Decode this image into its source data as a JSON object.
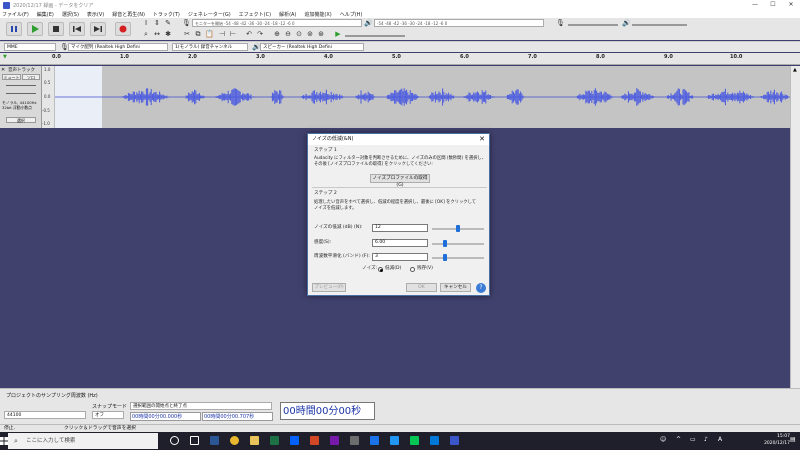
{
  "window": {
    "title": "2020/12/17 録画 - データをクリア",
    "controls": [
      "—",
      "☐",
      "✕"
    ]
  },
  "menu": [
    "ファイル(F)",
    "編集(E)",
    "選択(S)",
    "表示(V)",
    "録音と再生(N)",
    "トラック(T)",
    "ジェネレーター(G)",
    "エフェクト(C)",
    "解析(A)",
    "追加機能(X)",
    "ヘルプ(H)"
  ],
  "toolbar": {
    "monitor_label": "モニターを開始",
    "meter_scale": "-54  -48  -42  -36  -30  -24  -18  -12  -6  0",
    "meter_scale_small": "-54  -48  -42  -36  -30  -24  -18  -12  -6  0",
    "colors": {
      "play": "#2e9e2e",
      "record": "#d42020",
      "button": "#dcdcdc"
    }
  },
  "devices": {
    "host": "MME",
    "mic": "マイク配列 (Realtek High Defini",
    "channels": "1(モノラル) 録音チャンネル",
    "speaker": "スピーカー (Realtek High Defini"
  },
  "timeline": {
    "ticks": [
      "0.0",
      "1.0",
      "2.0",
      "3.0",
      "4.0",
      "5.0",
      "6.0",
      "7.0",
      "8.0",
      "9.0",
      "10.0"
    ]
  },
  "track": {
    "name": "音声トラック",
    "mute": "ミュート",
    "solo": "ソロ",
    "info_line1": "モノラル, 44100Hz",
    "info_line2": "32bit 浮動小数点",
    "select": "選択",
    "scale": [
      "1.0",
      "0.5",
      "0.0",
      "-0.5",
      "-1.0"
    ]
  },
  "dialog": {
    "title": "ノイズの低減(&N)",
    "close": "✕",
    "step1_heading": "ステップ 1",
    "step1_text1": "Audacity にフィルター対象を判断させるために、ノイズのみの区間 (数秒間) を選択し、",
    "step1_text2": "その後 [ノイズプロファイルの取得] をクリックしてください:",
    "profile_button": "ノイズプロファイルの取得(G)",
    "step2_heading": "ステップ 2",
    "step2_text1": "処理したい音声をすべて選択し、低減の程度を選択し、最後に [OK] をクリックして",
    "step2_text2": "ノイズを低減します。",
    "noise_label": "ノイズの低減 (dB) (N):",
    "noise_value": "12",
    "sensitivity_label": "感度(S):",
    "sensitivity_value": "6.00",
    "smoothing_label": "周波数平滑化 (バンド) (F):",
    "smoothing_value": "3",
    "noise_mode_label": "ノイズ:",
    "radio_reduce": "低減(D)",
    "radio_residue": "残存(V)",
    "preview_button": "プレビュー(P)",
    "ok_button": "OK",
    "cancel_button": "キャンセル",
    "help_button": "?",
    "levels": {
      "noise": 0.5,
      "sensitivity": 0.25,
      "smoothing": 0.25
    }
  },
  "selection_bar": {
    "rate_label": "プロジェクトのサンプリング周波数 (Hz)",
    "rate_value": "44100",
    "snap_label": "スナップモード",
    "snap_value": "オフ",
    "range_label": "選択範囲の開始点と終了点",
    "start_time": "00時間00分00.000秒",
    "end_time": "00時間00分00.707秒",
    "big_time": "00時間00分00秒"
  },
  "status": {
    "left": "停止.",
    "hint": "クリック＆ドラッグで音声を選択"
  },
  "taskbar": {
    "search_placeholder": "ここに入力して検索",
    "time": "15:07",
    "date": "2020/12/17"
  }
}
